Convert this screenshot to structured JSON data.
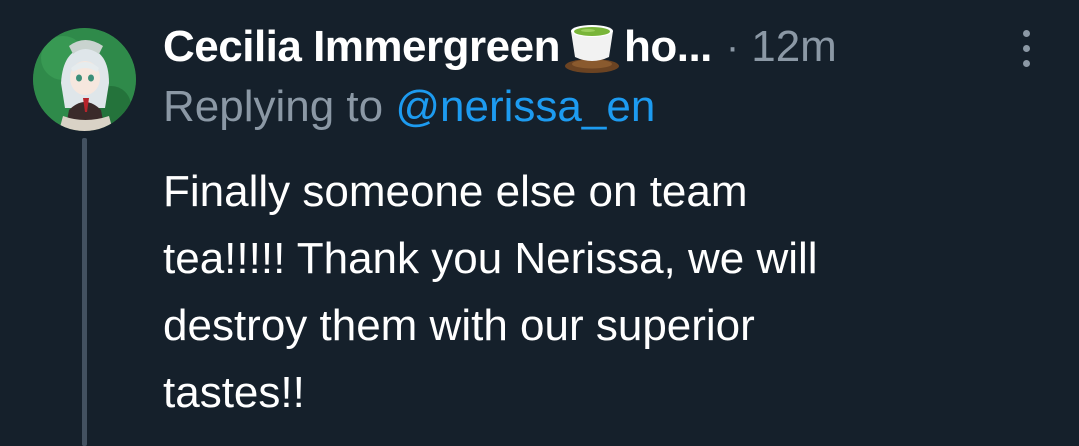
{
  "tweet": {
    "author_name": "Cecilia Immergreen",
    "author_name_tail": "ho...",
    "separator": "·",
    "time_ago": "12m",
    "reply_prefix": "Replying to",
    "reply_handle": "@nerissa_en",
    "body_lines": [
      "Finally someone else on team",
      "tea!!!!! Thank you Nerissa, we will",
      "destroy them with our superior",
      "tastes!!"
    ]
  },
  "icons": {
    "name_emoji": "tea-cup-icon",
    "more": "more-vertical-icon"
  },
  "colors": {
    "background": "#15202b",
    "primary_text": "#ffffff",
    "secondary_text": "#8b98a5",
    "link": "#1d9bf0",
    "thread_line": "#435160"
  }
}
